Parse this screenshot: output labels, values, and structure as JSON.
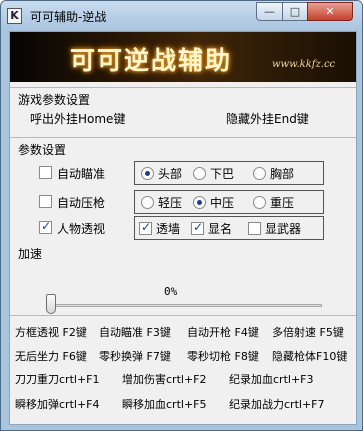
{
  "window": {
    "title": "可可辅助-逆战",
    "app_icon_glyph": "K",
    "controls": {
      "minimize": "—",
      "maximize": "□",
      "close": "✕"
    }
  },
  "banner": {
    "title": "可可逆战辅助",
    "subtitle": "www.kkfz.cc"
  },
  "game_params": {
    "title": "游戏参数设置",
    "show_hotkey": "呼出外挂Home键",
    "hide_hotkey": "隐藏外挂End键"
  },
  "params": {
    "title": "参数设置",
    "aim": {
      "label": "自动瞄准",
      "checked": false,
      "options": [
        "头部",
        "下巴",
        "胸部"
      ],
      "selected": 0
    },
    "recoil": {
      "label": "自动压枪",
      "checked": false,
      "options": [
        "轻压",
        "中压",
        "重压"
      ],
      "selected": 1
    },
    "esp": {
      "label": "人物透视",
      "checked": true,
      "options": [
        {
          "label": "透墙",
          "checked": true
        },
        {
          "label": "显名",
          "checked": true
        },
        {
          "label": "显武器",
          "checked": false
        }
      ]
    }
  },
  "speed": {
    "title": "加速",
    "value_label": "0%",
    "value": 0
  },
  "hotkeys": {
    "line1": [
      "方框透视 F2键",
      "自动瞄准 F3键",
      "自动开枪 F4键",
      "多倍射速 F5键"
    ],
    "line2": [
      "无后坐力 F6键",
      "零秒换弹 F7键",
      "零秒切枪 F8键",
      "隐藏枪体F10键"
    ],
    "line3": [
      "刀刀重刀crtl+F1",
      "增加伤害crtl+F2",
      "纪录加血crtl+F3"
    ],
    "line4": [
      "瞬移加弹crtl+F4",
      "瞬移加血crtl+F5",
      "纪录加战力crtl+F7"
    ]
  }
}
